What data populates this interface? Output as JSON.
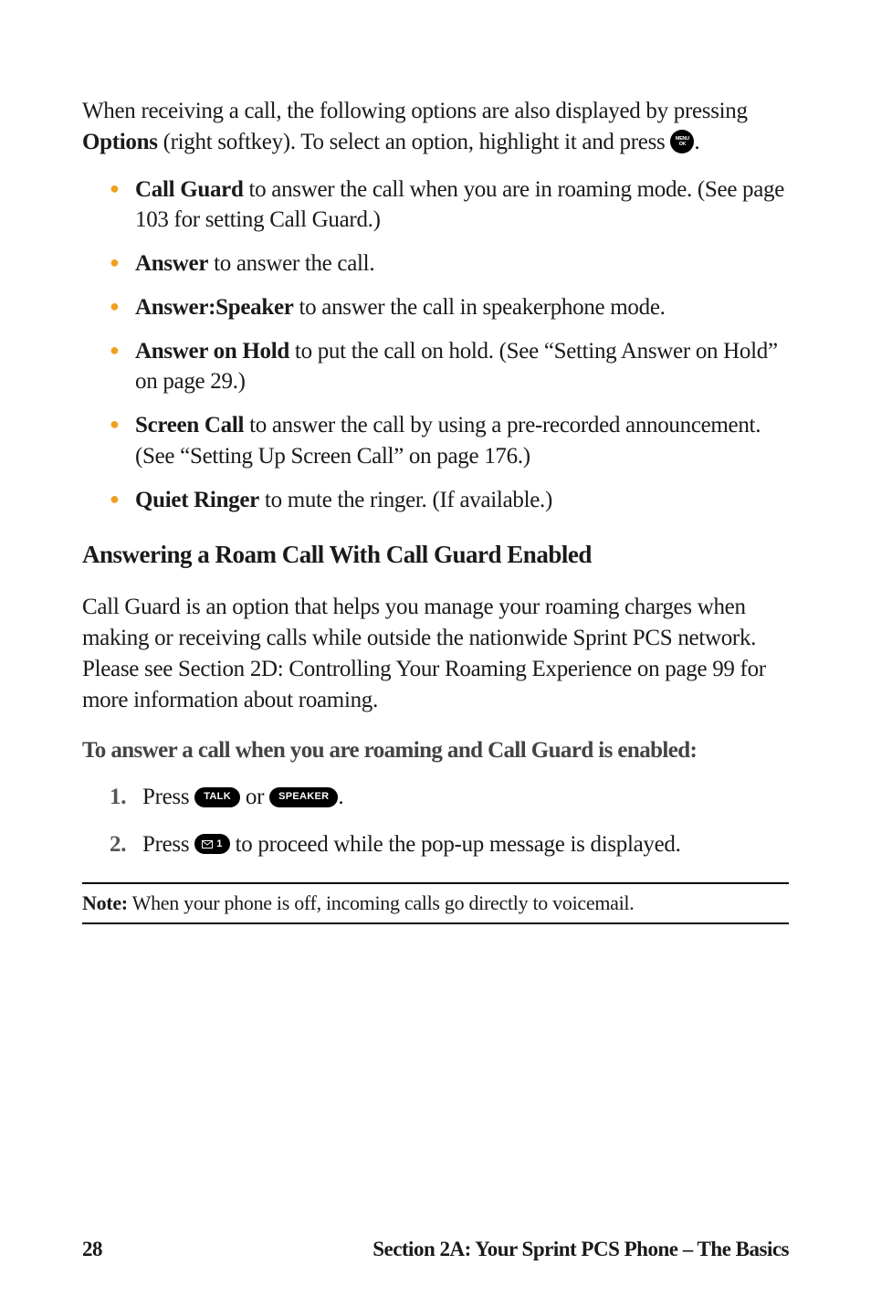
{
  "intro": {
    "part1": "When receiving a call, the following options are also displayed by pressing ",
    "options_word": "Options",
    "part2": " (right softkey). To select an option, highlight it and press ",
    "part3": "."
  },
  "bullets": [
    {
      "label": "Call Guard",
      "text": " to answer the call when you are in roaming mode. (See page 103 for setting Call Guard.)"
    },
    {
      "label": "Answer",
      "text": " to answer the call."
    },
    {
      "label": "Answer:Speaker",
      "text": " to answer the call in speakerphone mode."
    },
    {
      "label": "Answer on Hold",
      "text": " to put the call on hold. (See “Setting Answer on Hold” on page 29.)"
    },
    {
      "label": "Screen Call",
      "text": " to answer the call by using a pre-recorded announcement. (See “Setting Up Screen Call” on page 176.)"
    },
    {
      "label": "Quiet Ringer",
      "text": " to mute the ringer. (If available.)"
    }
  ],
  "subheading": "Answering a Roam Call With Call Guard Enabled",
  "paragraph": "Call Guard is an option that helps you manage your roaming charges when making or receiving calls while outside the nationwide Sprint PCS network. Please see Section 2D: Controlling Your Roaming Experience on page 99 for more information about roaming.",
  "bold_lead": "To answer a call when you are roaming and Call Guard is enabled:",
  "steps": {
    "s1": {
      "pre": "Press ",
      "mid": " or ",
      "post": "."
    },
    "s2": {
      "pre": "Press ",
      "post": " to proceed while the pop-up message is displayed."
    }
  },
  "buttons": {
    "talk": "TALK",
    "speaker": "SPEAKER",
    "one": "1"
  },
  "note": {
    "label": "Note:",
    "text": " When your phone is off, incoming calls go directly to voicemail."
  },
  "footer": {
    "page": "28",
    "section": "Section 2A: Your Sprint PCS Phone – The Basics"
  }
}
